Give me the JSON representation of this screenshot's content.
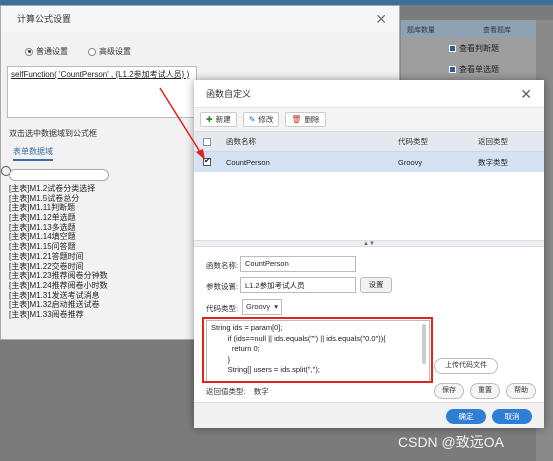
{
  "background": {
    "table_headers": [
      "题库数量",
      "查看题库"
    ],
    "rows": [
      "查看判断题",
      "查看单选题"
    ]
  },
  "formula_dialog": {
    "title": "计算公式设置",
    "modes": {
      "normal": "普通设置",
      "advanced": "高级设置"
    },
    "formula_text": "selfFunction( 'CountPerson' , {L1.2参加考试人员} )",
    "hint": "双击选中数据域到公式框",
    "tab_label": "表单数据域",
    "fields": [
      "[主表]M1.2试卷分类选择",
      "[主表]M1.5试卷总分",
      "[主表]M1.11判断题",
      "[主表]M1.12单选题",
      "[主表]M1.13多选题",
      "[主表]M1.14填空题",
      "[主表]M1.15问答题",
      "[主表]M1.21答题时间",
      "[主表]M1.22交卷时间",
      "[主表]M1.23推荐阅卷分钟数",
      "[主表]M1.24推荐阅卷小时数",
      "[主表]M1.31发送考试消息",
      "[主表]M1.32启动推送试卷",
      "[主表]M1.33阅卷推荐"
    ]
  },
  "func_dialog": {
    "title": "函数自定义",
    "toolbar": {
      "new": "新建",
      "edit": "修改",
      "delete": "删除"
    },
    "columns": {
      "name": "函数名称",
      "code_type": "代码类型",
      "return_type": "返回类型"
    },
    "row": {
      "name": "CountPerson",
      "code_type": "Groovy",
      "return_type": "数字类型"
    },
    "form": {
      "name_label": "函数名称:",
      "name_value": "CountPerson",
      "param_label": "参数设置:",
      "param_value": "L1.2参加考试人员",
      "param_button": "设置",
      "code_type_label": "代码类型:",
      "code_type_value": "Groovy",
      "code_lines": [
        "String ids = param[0];",
        "        if (ids==null || ids.equals(\"\") || ids.equals(\"0.0\")){",
        "          return 0;",
        "        }",
        "        String[] users = ids.split(\",\");"
      ],
      "upload_button": "上传代码文件",
      "return_label": "返回值类型:",
      "return_value": "数字",
      "save_button": "保存",
      "reset_button": "重置",
      "help_button": "帮助"
    },
    "ok": "确定",
    "cancel": "取消"
  },
  "watermark": "CSDN @致远OA",
  "colors": {
    "accent": "#2f7ed6",
    "highlight": "#e0231c",
    "selected_row": "#d4e3f4"
  }
}
